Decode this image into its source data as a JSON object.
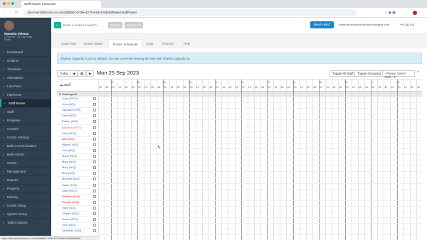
{
  "browser": {
    "tab_title": "Staff Roster | Discover",
    "url": "discoverchildcare.co.nz/4ddd0bb7-b78e-427f-8c66-fc9d5b9f9a6e/StaffRoster"
  },
  "sidebar": {
    "user_name": "Natasha Veiman",
    "user_role": "Z Support - All Day Kindy",
    "user_role2": "Taura",
    "items": [
      {
        "label": "Dashboard",
        "icon": "dashboard-icon",
        "arrow": ""
      },
      {
        "label": "Children",
        "icon": "children-icon",
        "arrow": ""
      },
      {
        "label": "Transition",
        "icon": "transition-icon",
        "arrow": ""
      },
      {
        "label": "Attendance",
        "icon": "attendance-icon",
        "arrow": "‹"
      },
      {
        "label": "Late Fees",
        "icon": "late-fees-icon",
        "arrow": ""
      },
      {
        "label": "Payments",
        "icon": "payments-icon",
        "arrow": "‹"
      },
      {
        "label": "Staff Roster",
        "icon": "staff-roster-icon",
        "arrow": ""
      },
      {
        "label": "Staff",
        "icon": "staff-icon",
        "arrow": "‹"
      },
      {
        "label": "Enquiries",
        "icon": "enquiries-icon",
        "arrow": "‹"
      },
      {
        "label": "Centres",
        "icon": "centres-icon",
        "arrow": ""
      },
      {
        "label": "Centre Settings",
        "icon": "centre-settings-icon",
        "arrow": ""
      },
      {
        "label": "Bulk Communication",
        "icon": "bulk-communication-icon",
        "arrow": ""
      },
      {
        "label": "Bulk Actions",
        "icon": "bulk-actions-icon",
        "arrow": ""
      },
      {
        "label": "Centre",
        "icon": "centre-icon",
        "arrow": "‹"
      },
      {
        "label": "Management",
        "icon": "management-icon",
        "arrow": "‹"
      },
      {
        "label": "Reports",
        "icon": "reports-icon",
        "arrow": "‹"
      },
      {
        "label": "Property",
        "icon": "property-icon",
        "arrow": "‹"
      },
      {
        "label": "Ministry",
        "icon": "ministry-icon",
        "arrow": "‹"
      },
      {
        "label": "Centre Setup",
        "icon": "centre-setup-icon",
        "arrow": "‹"
      },
      {
        "label": "System Setup",
        "icon": "system-setup-icon",
        "arrow": "‹"
      },
      {
        "label": "Tablet Options",
        "icon": "tablet-options-icon",
        "arrow": "‹"
      }
    ]
  },
  "topbar": {
    "search_placeholder": "Enter a name to search...",
    "search_btn": "Search",
    "search_all_btn": "Search All",
    "need_help": "Need Help?",
    "user_email": "natasha.veiman@vprotechnologies.com",
    "logout": "Log out"
  },
  "tabs": [
    {
      "label": "Quick Add"
    },
    {
      "label": "Roster Sheet"
    },
    {
      "label": "Roster Scheduler"
    },
    {
      "label": "Copy"
    },
    {
      "label": "Reports"
    },
    {
      "label": "Help"
    }
  ],
  "info_text": "Shared Capacity is on by default. You are currently viewing the day with shared capacity on.",
  "toolbar": {
    "today": "Today",
    "prev": "◀",
    "calendar": "▦",
    "next": "▶",
    "date": "Mon 25 Sep 2023",
    "toggle_all": "Toggle All Staff",
    "toggle_grouping": "Toggle Grouping",
    "task_select": "--Please Select Task--",
    "add": "+"
  },
  "grid": {
    "staff_header": "Staff",
    "group_label": "Unassigned",
    "hours": [
      "07",
      "08",
      "09",
      "10",
      "11",
      "12",
      "13",
      "14",
      "15",
      "16",
      "17",
      "18",
      "19"
    ],
    "minute_labels": [
      "30",
      "45",
      "00",
      "15",
      "30",
      "45"
    ],
    "staff": [
      {
        "name": "Luisa (REG)",
        "color": "#3c6cb4"
      },
      {
        "name": "Jess (N/Q)",
        "color": "#3c6cb4"
      },
      {
        "name": "Candace (PRI)",
        "color": "#3c6cb4"
      },
      {
        "name": "Kaia (REG)",
        "color": "#3c6cb4"
      },
      {
        "name": "Esther (N/Q)",
        "color": "#3c6cb4"
      },
      {
        "name": "Natasha (REG)",
        "color": "#e8742c"
      },
      {
        "name": "Irene (N/Q)",
        "color": "#3c6cb4"
      },
      {
        "name": "Alex (N/Q)",
        "color": "#d42020"
      },
      {
        "name": "Hayleh (N/Q)",
        "color": "#3c6cb4"
      },
      {
        "name": "Lola (N/Q)",
        "color": "#3c6cb4"
      },
      {
        "name": "Maria (N/Q)",
        "color": "#3c6cb4"
      },
      {
        "name": "Mary (N/Q)",
        "color": "#3c6cb4"
      },
      {
        "name": "Mary (N/Q)",
        "color": "#3c6cb4"
      },
      {
        "name": "Matt (N/Q)",
        "color": "#3c6cb4"
      },
      {
        "name": "Michelle (N/Q)",
        "color": "#3c6cb4"
      },
      {
        "name": "Sakar (N/Q)",
        "color": "#3c6cb4"
      },
      {
        "name": "Sam (REG)",
        "color": "#3c6cb4"
      },
      {
        "name": "Siobhan (N/Q)",
        "color": "#d42020"
      },
      {
        "name": "Suzelle (N/Q)",
        "color": "#d42020"
      },
      {
        "name": "Todd (N/Q)",
        "color": "#3c6cb4"
      },
      {
        "name": "Charlie (N/Q)",
        "color": "#3c6cb4"
      },
      {
        "name": "Grace (REG)",
        "color": "#3c6cb4"
      },
      {
        "name": "John (N/Q)",
        "color": "#3c6cb4"
      },
      {
        "name": "Jonathan (N/Q)",
        "color": "#3c6cb4"
      }
    ]
  },
  "status_bar": "https://discoverchildcare.co.nz/4ddd0bb7-b78e-427f-8c66-fc9d5b9f9a6e",
  "colors": {
    "sidebar": "#2f4050",
    "accent": "#1ab394",
    "help": "#1c84c6",
    "minute_red": "#d42020",
    "minute_green": "#1e9a3a"
  }
}
